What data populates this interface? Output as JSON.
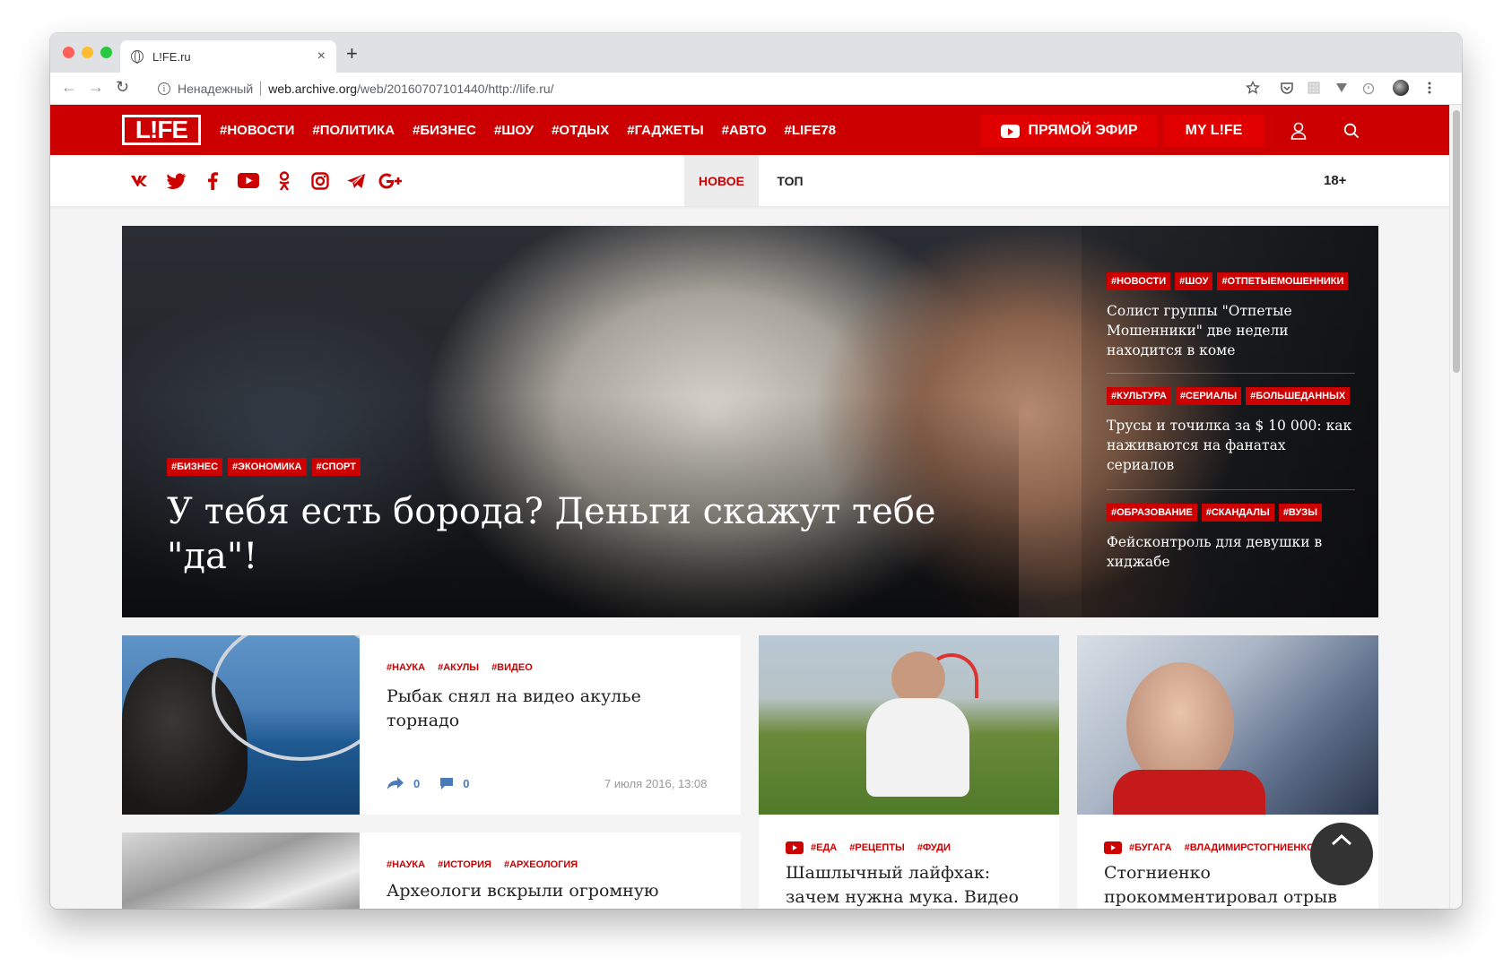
{
  "browser": {
    "tab_title": "L!FE.ru",
    "tab_close": "×",
    "new_tab": "+",
    "back": "←",
    "forward": "→",
    "reload": "↻",
    "info_glyph": "i",
    "insecure_label": "Ненадежный",
    "url_domain": "web.archive.org",
    "url_path": "/web/20160707101440/http://life.ru/"
  },
  "header": {
    "logo": "L!FE",
    "nav": [
      "#НОВОСТИ",
      "#ПОЛИТИКА",
      "#БИЗНЕС",
      "#ШОУ",
      "#ОТДЫХ",
      "#ГАДЖЕТЫ",
      "#АВТО",
      "#LIFE78"
    ],
    "live_label": "ПРЯМОЙ ЭФИР",
    "mylife_label": "MY L!FE"
  },
  "subbar": {
    "socials": [
      "vk-icon",
      "twitter-icon",
      "facebook-icon",
      "youtube-icon",
      "odnoklassniki-icon",
      "instagram-icon",
      "telegram-icon",
      "google-plus-icon"
    ],
    "tab_new": "НОВОЕ",
    "tab_top": "ТОП",
    "age": "18+"
  },
  "hero": {
    "tags": [
      "#БИЗНЕС",
      "#ЭКОНОМИКА",
      "#СПОРТ"
    ],
    "title": "У тебя есть борода? Деньги скажут тебе \"да\"!",
    "side": [
      {
        "tags": [
          "#НОВОСТИ",
          "#ШОУ",
          "#ОТПЕТЫЕМОШЕННИКИ"
        ],
        "title": "Солист группы \"Отпетые Мошенники\" две недели находится в коме"
      },
      {
        "tags": [
          "#КУЛЬТУРА",
          "#СЕРИАЛЫ",
          "#БОЛЬШЕДАННЫХ"
        ],
        "title": "Трусы и точилка за $ 10 000: как наживаются на фанатах сериалов"
      },
      {
        "tags": [
          "#ОБРАЗОВАНИЕ",
          "#СКАНДАЛЫ",
          "#ВУЗЫ"
        ],
        "title": "Фейсконтроль для девушки в хиджабе"
      }
    ]
  },
  "cards": {
    "shark": {
      "tags": [
        "#НАУКА",
        "#АКУЛЫ",
        "#ВИДЕО"
      ],
      "title": "Рыбак снял на видео акулье торнадо",
      "shares": "0",
      "comments": "0",
      "date": "7 июля 2016, 13:08"
    },
    "archeo": {
      "tags": [
        "#НАУКА",
        "#ИСТОРИЯ",
        "#АРХЕОЛОГИЯ"
      ],
      "title": "Археологи вскрыли огромную сеть"
    },
    "food": {
      "tags": [
        "#ЕДА",
        "#РЕЦЕПТЫ",
        "#ФУДИ"
      ],
      "title": "Шашлычный лайфхак: зачем нужна мука. Видео"
    },
    "stog": {
      "tags": [
        "#БУГАГА",
        "#ВЛАДИМИРСТОГНИЕНКО"
      ],
      "title": "Стогниенко прокомментировал отрыв"
    }
  }
}
